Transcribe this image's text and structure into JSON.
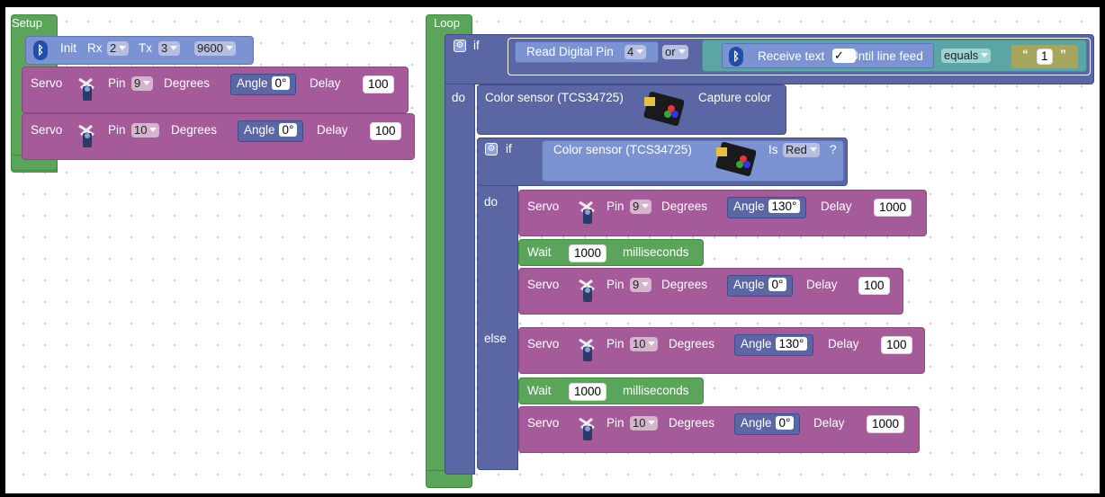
{
  "icons": {
    "bt": "bluetooth-icon",
    "servo": "servo-icon",
    "gear": "gear-icon",
    "sensor": "color-sensor-image"
  },
  "colors": {
    "control": "#5ba55b",
    "logic": "#5b67a5",
    "servo": "#a55b99"
  },
  "setup": {
    "label": "Setup",
    "init": {
      "label": "Init",
      "rx_label": "Rx",
      "rx": "2",
      "tx_label": "Tx",
      "tx": "3",
      "baud": "9600"
    },
    "servos": [
      {
        "label": "Servo",
        "pin_label": "Pin",
        "pin": "9",
        "deg_label": "Degrees",
        "angle_label": "Angle",
        "angle": "0°",
        "delay_label": "Delay",
        "delay": "100"
      },
      {
        "label": "Servo",
        "pin_label": "Pin",
        "pin": "10",
        "deg_label": "Degrees",
        "angle_label": "Angle",
        "angle": "0°",
        "delay_label": "Delay",
        "delay": "100"
      }
    ]
  },
  "loop": {
    "label": "Loop",
    "if_label": "if",
    "do_label": "do",
    "else_label": "else",
    "read_pin_label": "Read Digital Pin",
    "read_pin": "4",
    "or_label": "or",
    "receive_label": "Receive text",
    "checkbox": "✓",
    "until_label": "Until line feed",
    "equals": "equals",
    "quote_open": "“",
    "quote_value": "1",
    "quote_close": "”",
    "capture": {
      "sensor_label": "Color sensor (TCS34725)",
      "action": "Capture color"
    },
    "is_color": {
      "sensor_label": "Color sensor (TCS34725)",
      "is_label": "Is",
      "color": "Red",
      "q": "?"
    },
    "do_servo1": {
      "label": "Servo",
      "pin_label": "Pin",
      "pin": "9",
      "deg_label": "Degrees",
      "angle_label": "Angle",
      "angle": "130°",
      "delay_label": "Delay",
      "delay": "1000"
    },
    "wait1": {
      "label": "Wait",
      "value": "1000",
      "unit": "milliseconds"
    },
    "do_servo2": {
      "label": "Servo",
      "pin_label": "Pin",
      "pin": "9",
      "deg_label": "Degrees",
      "angle_label": "Angle",
      "angle": "0°",
      "delay_label": "Delay",
      "delay": "100"
    },
    "else_servo1": {
      "label": "Servo",
      "pin_label": "Pin",
      "pin": "10",
      "deg_label": "Degrees",
      "angle_label": "Angle",
      "angle": "130°",
      "delay_label": "Delay",
      "delay": "100"
    },
    "wait2": {
      "label": "Wait",
      "value": "1000",
      "unit": "milliseconds"
    },
    "else_servo2": {
      "label": "Servo",
      "pin_label": "Pin",
      "pin": "10",
      "deg_label": "Degrees",
      "angle_label": "Angle",
      "angle": "0°",
      "delay_label": "Delay",
      "delay": "1000"
    }
  }
}
